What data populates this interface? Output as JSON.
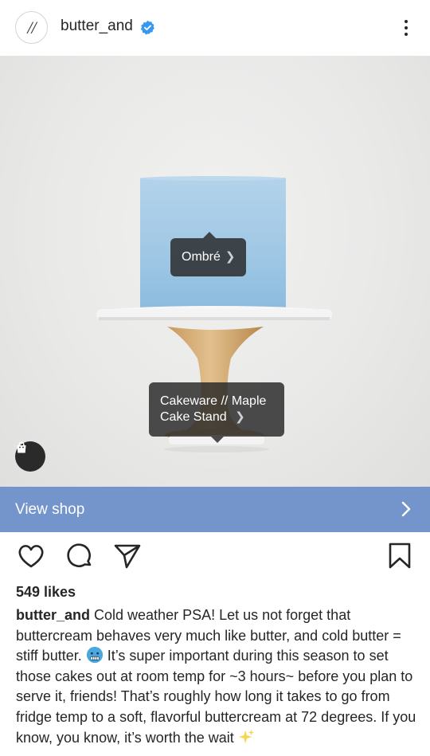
{
  "header": {
    "avatar_text": "//",
    "username": "butter_and",
    "verified": true
  },
  "photo": {
    "tags": [
      {
        "label": "Ombré"
      },
      {
        "label_line1": "Cakeware // Maple",
        "label_line2": "Cake Stand"
      }
    ]
  },
  "shop": {
    "label": "View shop"
  },
  "actions": {
    "icons": [
      "heart-icon",
      "comment-icon",
      "share-icon",
      "bookmark-icon"
    ]
  },
  "post": {
    "likes": "549 likes",
    "caption_user": "butter_and",
    "caption_text_1": " Cold weather PSA! Let us not forget that buttercream behaves very much like butter, and cold butter = stiff butter. ",
    "caption_text_2": " It’s super important during this season to set those cakes out at room temp for ~3 hours~ before you plan to serve it, friends! That’s roughly how long it takes to go from fridge temp to a soft, flavorful buttercream at 72 degrees. If you know, you know, it’s worth the wait ",
    "emoji_1": "cold-face-emoji",
    "emoji_2": "sparkles-emoji"
  },
  "colors": {
    "shop_bar": "#7395cb",
    "verified": "#3897f0",
    "cake_top": "#a9cde7",
    "cake_bottom": "#8fbde0"
  }
}
